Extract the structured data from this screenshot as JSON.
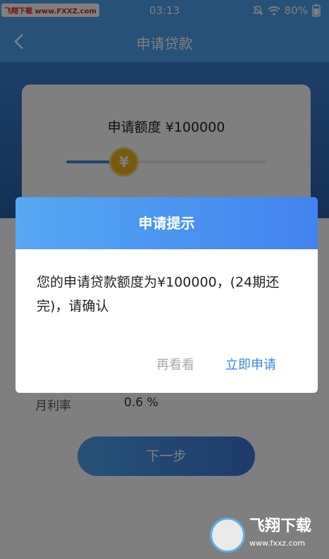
{
  "status_bar": {
    "time": "03:13",
    "battery": "80%"
  },
  "watermarks": {
    "top": "飞翔下载 www.FXXZ.com",
    "bottom_title": "飞翔下载",
    "bottom_url": "www.fxxz.com"
  },
  "nav": {
    "title": "申请贷款"
  },
  "card": {
    "amount_text": "申请额度 ¥100000",
    "thumb_symbol": "¥",
    "slider_fraction": 0.25
  },
  "info": {
    "rate_label": "月利率",
    "rate_value": "0.6 %"
  },
  "next_button": {
    "label": "下一步"
  },
  "dialog": {
    "title": "申请提示",
    "message": "您的申请贷款额度为¥100000，(24期还完)，请确认",
    "cancel_label": "再看看",
    "confirm_label": "立即申请"
  }
}
